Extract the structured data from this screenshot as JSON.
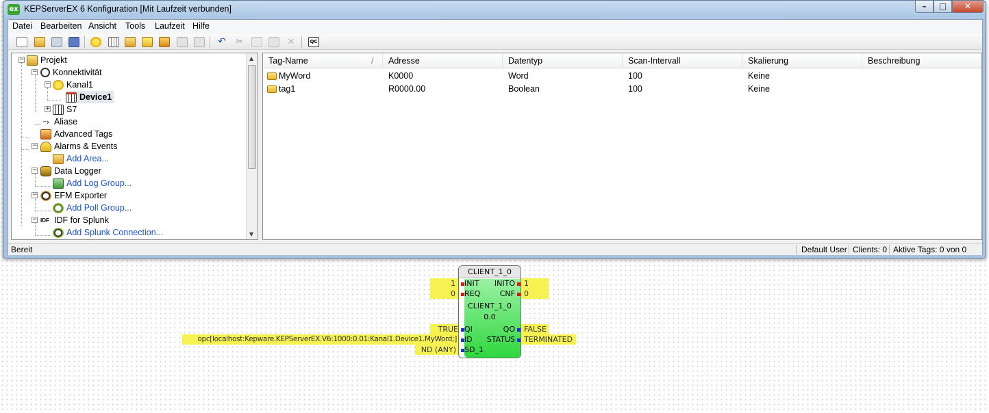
{
  "window": {
    "title": "KEPServerEX 6 Konfiguration [Mit Laufzeit verbunden]",
    "app_icon_text": "ex",
    "controls": {
      "minimize": "–",
      "maximize": "□",
      "close": "✕"
    }
  },
  "menu": [
    "Datei",
    "Bearbeiten",
    "Ansicht",
    "Tools",
    "Laufzeit",
    "Hilfe"
  ],
  "toolbar": {
    "icons": [
      "new-icon",
      "open-icon",
      "save-icon",
      "save-as-icon",
      "new-channel-icon",
      "new-device-icon",
      "new-group-icon",
      "new-tag-icon",
      "bulk-tag-icon",
      "import-icon",
      "undo-icon",
      "cut-icon",
      "copy-icon",
      "paste-icon",
      "delete-icon",
      "quick-client-icon"
    ],
    "quick_client_text": "QC"
  },
  "tree": {
    "items": [
      {
        "label": "Projekt"
      },
      {
        "label": "Konnektivität"
      },
      {
        "label": "Kanal1"
      },
      {
        "label": "Device1"
      },
      {
        "label": "S7"
      },
      {
        "label": "Aliase"
      },
      {
        "label": "Advanced Tags"
      },
      {
        "label": "Alarms & Events"
      },
      {
        "label": "Add Area..."
      },
      {
        "label": "Data Logger"
      },
      {
        "label": "Add Log Group..."
      },
      {
        "label": "EFM Exporter"
      },
      {
        "label": "Add Poll Group..."
      },
      {
        "label": "IDF for Splunk"
      },
      {
        "label": "Add Splunk Connection..."
      }
    ],
    "expander_minus": "−",
    "expander_plus": "+",
    "scroll_up": "▲",
    "scroll_down": "▼",
    "idf_badge": "IDF"
  },
  "tag_table": {
    "columns": [
      "Tag-Name",
      "Adresse",
      "Datentyp",
      "Scan-Intervall",
      "Skalierung",
      "Beschreibung"
    ],
    "sort_glyph": "/",
    "rows": [
      {
        "name": "MyWord",
        "address": "K0000",
        "type": "Word",
        "scan": "100",
        "scaling": "Keine",
        "description": ""
      },
      {
        "name": "tag1",
        "address": "R0000.00",
        "type": "Boolean",
        "scan": "100",
        "scaling": "Keine",
        "description": ""
      }
    ]
  },
  "status": {
    "left": "Bereit",
    "user": "Default User",
    "clients": "Clients: 0",
    "active_tags": "Aktive Tags: 0 von 0"
  },
  "function_block": {
    "instance_name": "CLIENT_1_0",
    "type_name": "CLIENT_1_0",
    "version": "0.0",
    "inputs": [
      {
        "pin": "INIT",
        "value": "1"
      },
      {
        "pin": "REQ",
        "value": "0"
      },
      {
        "pin": "QI",
        "value": "TRUE"
      },
      {
        "pin": "ID",
        "value": "opc[localhost:Kepware.KEPServerEX.V6:1000:0.01:Kanal1.Device1.MyWord;]"
      },
      {
        "pin": "SD_1",
        "value": "ND (ANY)"
      }
    ],
    "outputs": [
      {
        "pin": "INITO",
        "value": "1"
      },
      {
        "pin": "CNF",
        "value": "0"
      },
      {
        "pin": "QO",
        "value": "FALSE"
      },
      {
        "pin": "STATUS",
        "value": "TERMINATED"
      }
    ],
    "colors": {
      "event_pin": "#e21515",
      "data_pin": "#1a2ee6",
      "body_top": "#9bf1a3",
      "body_bottom": "#2fd83f",
      "highlight": "#f5f251"
    }
  }
}
